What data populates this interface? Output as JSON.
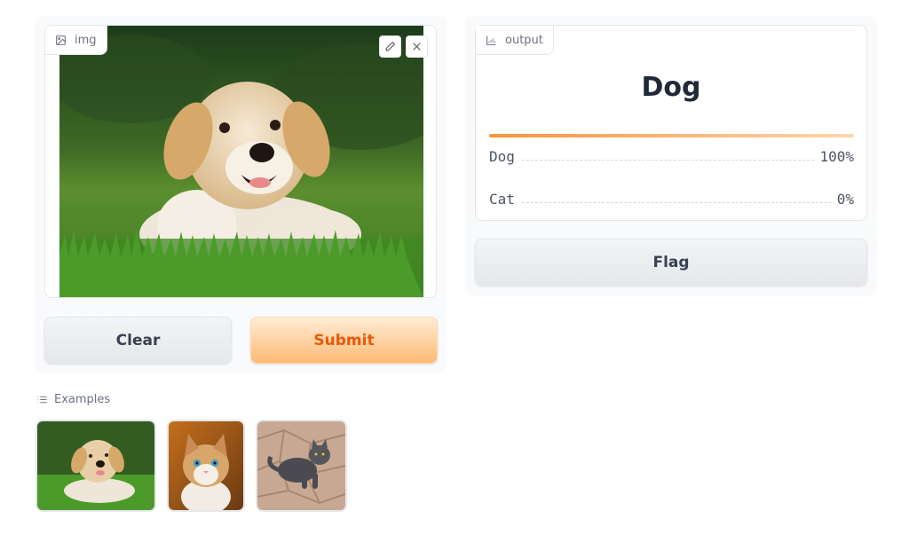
{
  "input": {
    "label": "img",
    "edit_icon": "pencil-icon",
    "clear_icon": "close-icon"
  },
  "buttons": {
    "clear": "Clear",
    "submit": "Submit",
    "flag": "Flag"
  },
  "output": {
    "label": "output",
    "top_label": "Dog",
    "confidences": [
      {
        "label": "Dog",
        "value": "100%",
        "fraction": 1.0
      },
      {
        "label": "Cat",
        "value": "0%",
        "fraction": 0.0
      }
    ]
  },
  "examples": {
    "label": "Examples",
    "items": [
      "puppy",
      "kitten",
      "gray-cat"
    ]
  },
  "colors": {
    "accent": "#ea580c",
    "accent_light": "#fdba74"
  }
}
